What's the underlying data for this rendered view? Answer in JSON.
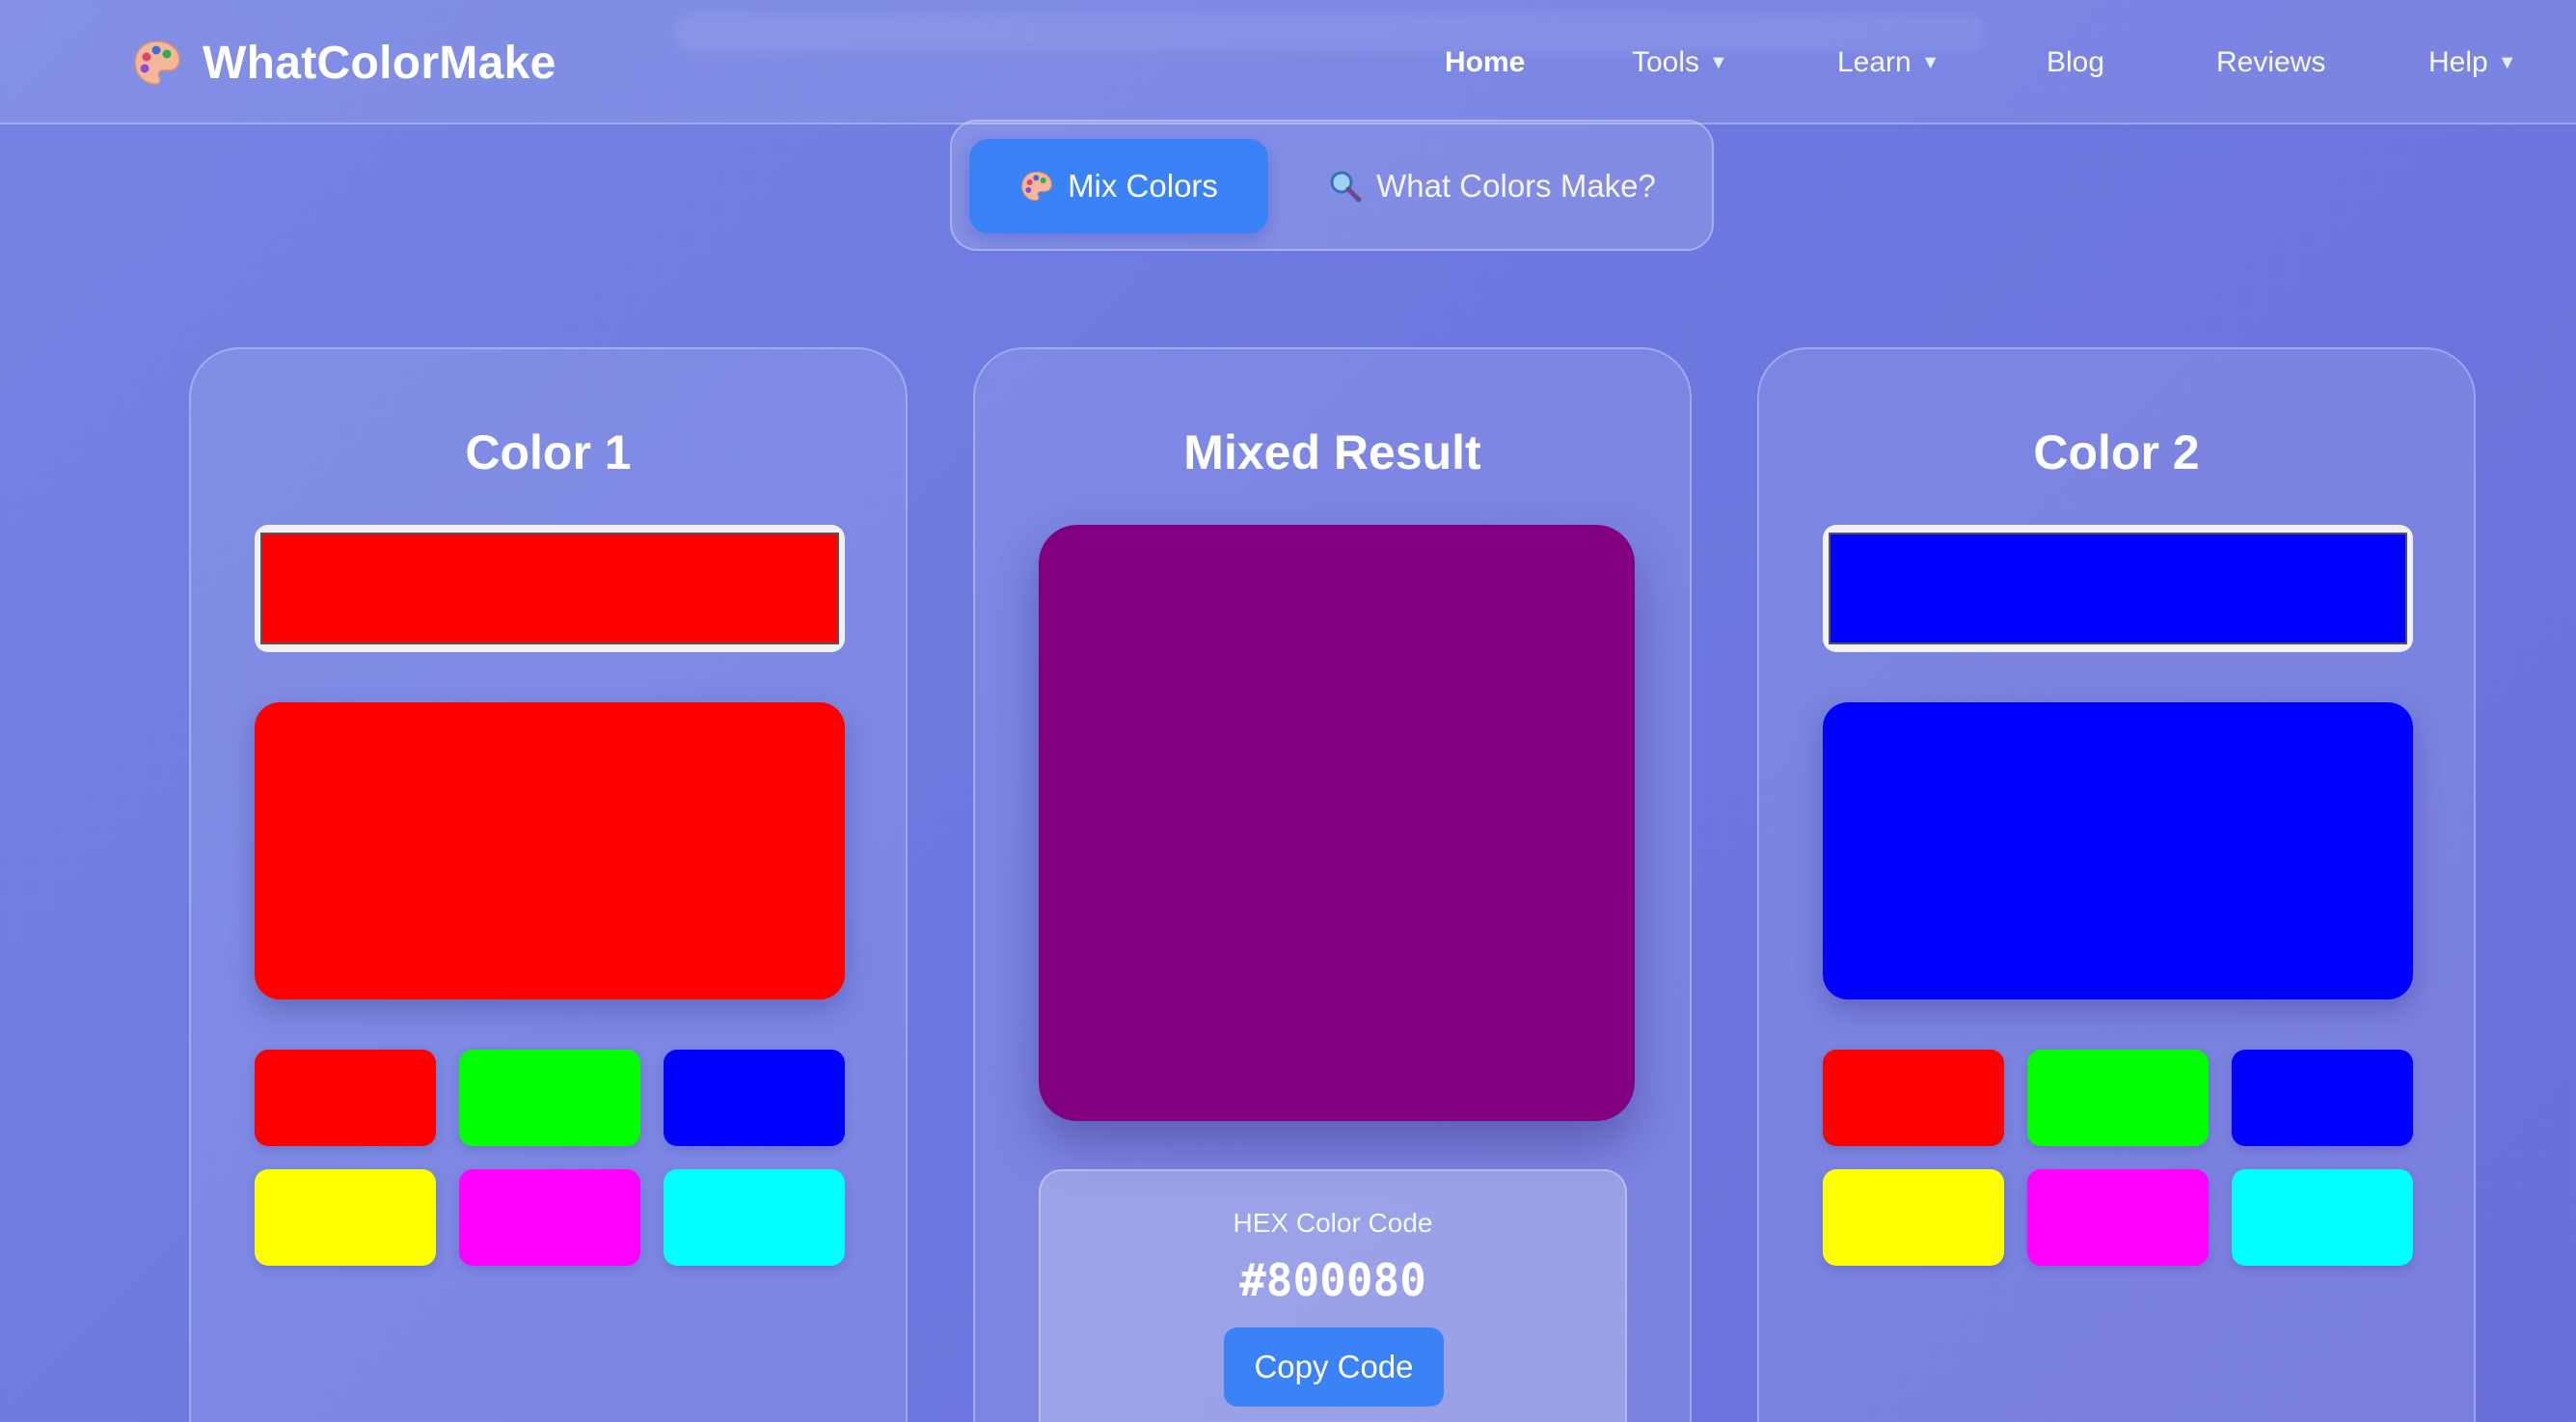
{
  "brand": {
    "name": "WhatColorMake",
    "icon": "palette-icon"
  },
  "nav": {
    "items": [
      {
        "label": "Home",
        "active": true,
        "dropdown": false
      },
      {
        "label": "Tools",
        "active": false,
        "dropdown": true
      },
      {
        "label": "Learn",
        "active": false,
        "dropdown": true
      },
      {
        "label": "Blog",
        "active": false,
        "dropdown": false
      },
      {
        "label": "Reviews",
        "active": false,
        "dropdown": false
      },
      {
        "label": "Help",
        "active": false,
        "dropdown": true
      }
    ],
    "caret": "▼"
  },
  "mode_toggle": {
    "mix": {
      "label": "Mix Colors",
      "icon": "palette-icon",
      "active": true
    },
    "what": {
      "label": "What Colors Make?",
      "icon": "magnifier-icon",
      "active": false
    }
  },
  "color1": {
    "title": "Color 1",
    "value": "#ff0000",
    "presets": [
      "#ff0000",
      "#00ff00",
      "#0000ff",
      "#ffff00",
      "#ff00ff",
      "#00ffff"
    ]
  },
  "result": {
    "title": "Mixed Result",
    "color": "#800080",
    "hex_label": "HEX Color Code",
    "hex_value": "#800080",
    "copy_label": "Copy Code"
  },
  "color2": {
    "title": "Color 2",
    "value": "#0000ff",
    "presets": [
      "#ff0000",
      "#00ff00",
      "#0000ff",
      "#ffff00",
      "#ff00ff",
      "#00ffff"
    ]
  },
  "colors": {
    "accent": "#3b82f6"
  }
}
